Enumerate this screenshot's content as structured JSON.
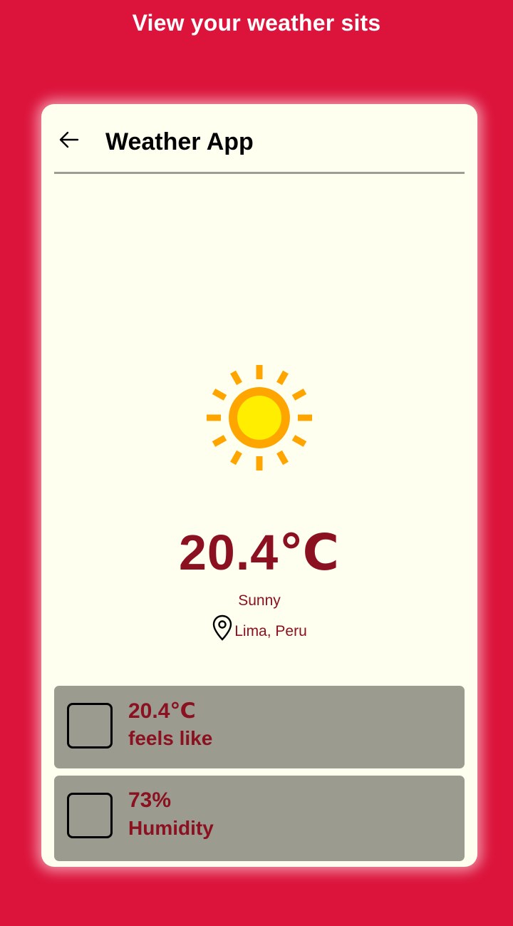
{
  "page": {
    "heading": "View your weather sits"
  },
  "app_bar": {
    "title": "Weather App",
    "back_icon": "arrow-left-icon"
  },
  "weather": {
    "icon": "sun-icon",
    "temperature": "20.4℃",
    "condition": "Sunny",
    "location_icon": "map-pin-icon",
    "location": "Lima, Peru"
  },
  "details": [
    {
      "value": "20.4℃",
      "label": "feels like"
    },
    {
      "value": "73%",
      "label": "Humidity"
    }
  ],
  "colors": {
    "background": "#dc143c",
    "card": "#fffff0",
    "accent_text": "#8b1020",
    "detail_card": "#9b9b90",
    "sun_outer": "#ffa500",
    "sun_inner": "#ffee00"
  }
}
